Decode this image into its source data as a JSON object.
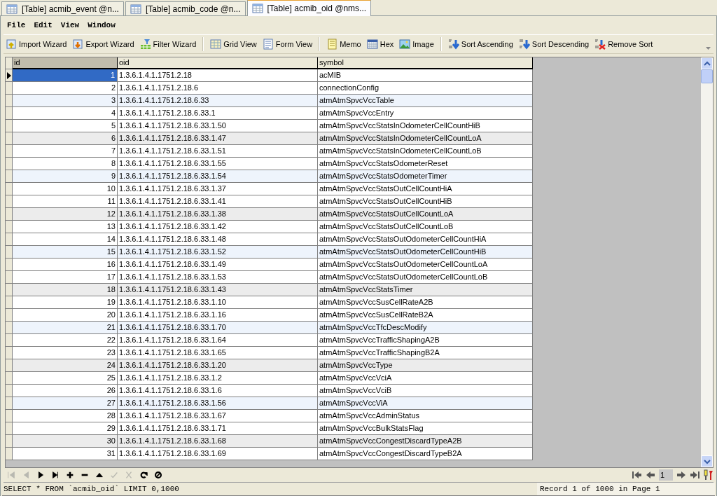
{
  "tabs": [
    {
      "label": "[Table] acmib_event @n...",
      "selected": false
    },
    {
      "label": "[Table] acmib_code @n...",
      "selected": false
    },
    {
      "label": "[Table] acmib_oid @nms...",
      "selected": true
    }
  ],
  "menu": [
    "File",
    "Edit",
    "View",
    "Window"
  ],
  "toolbar": [
    {
      "kind": "import",
      "label": "Import Wizard"
    },
    {
      "kind": "export",
      "label": "Export Wizard"
    },
    {
      "kind": "filter",
      "label": "Filter Wizard"
    },
    {
      "kind": "separator"
    },
    {
      "kind": "grid",
      "label": "Grid View"
    },
    {
      "kind": "form",
      "label": "Form View"
    },
    {
      "kind": "separator"
    },
    {
      "kind": "memo",
      "label": "Memo"
    },
    {
      "kind": "hex",
      "label": "Hex"
    },
    {
      "kind": "image",
      "label": "Image"
    },
    {
      "kind": "separator"
    },
    {
      "kind": "sort-asc",
      "label": "Sort Ascending"
    },
    {
      "kind": "sort-desc",
      "label": "Sort Descending"
    },
    {
      "kind": "sort-remove",
      "label": "Remove Sort"
    }
  ],
  "table": {
    "columns": [
      "id",
      "oid",
      "symbol"
    ],
    "rows": [
      {
        "id": "1",
        "oid": "1.3.6.1.4.1.1751.2.18",
        "symbol": "acMIB",
        "selected": true
      },
      {
        "id": "2",
        "oid": "1.3.6.1.4.1.1751.2.18.6",
        "symbol": "connectionConfig",
        "selected": false
      },
      {
        "id": "3",
        "oid": "1.3.6.1.4.1.1751.2.18.6.33",
        "symbol": "atmAtmSpvcVccTable",
        "selected": false
      },
      {
        "id": "4",
        "oid": "1.3.6.1.4.1.1751.2.18.6.33.1",
        "symbol": "atmAtmSpvcVccEntry",
        "selected": false
      },
      {
        "id": "5",
        "oid": "1.3.6.1.4.1.1751.2.18.6.33.1.50",
        "symbol": "atmAtmSpvcVccStatsInOdometerCellCountHiB",
        "selected": false
      },
      {
        "id": "6",
        "oid": "1.3.6.1.4.1.1751.2.18.6.33.1.47",
        "symbol": "atmAtmSpvcVccStatsInOdometerCellCountLoA",
        "selected": false
      },
      {
        "id": "7",
        "oid": "1.3.6.1.4.1.1751.2.18.6.33.1.51",
        "symbol": "atmAtmSpvcVccStatsInOdometerCellCountLoB",
        "selected": false
      },
      {
        "id": "8",
        "oid": "1.3.6.1.4.1.1751.2.18.6.33.1.55",
        "symbol": "atmAtmSpvcVccStatsOdometerReset",
        "selected": false
      },
      {
        "id": "9",
        "oid": "1.3.6.1.4.1.1751.2.18.6.33.1.54",
        "symbol": "atmAtmSpvcVccStatsOdometerTimer",
        "selected": false
      },
      {
        "id": "10",
        "oid": "1.3.6.1.4.1.1751.2.18.6.33.1.37",
        "symbol": "atmAtmSpvcVccStatsOutCellCountHiA",
        "selected": false
      },
      {
        "id": "11",
        "oid": "1.3.6.1.4.1.1751.2.18.6.33.1.41",
        "symbol": "atmAtmSpvcVccStatsOutCellCountHiB",
        "selected": false
      },
      {
        "id": "12",
        "oid": "1.3.6.1.4.1.1751.2.18.6.33.1.38",
        "symbol": "atmAtmSpvcVccStatsOutCellCountLoA",
        "selected": false
      },
      {
        "id": "13",
        "oid": "1.3.6.1.4.1.1751.2.18.6.33.1.42",
        "symbol": "atmAtmSpvcVccStatsOutCellCountLoB",
        "selected": false
      },
      {
        "id": "14",
        "oid": "1.3.6.1.4.1.1751.2.18.6.33.1.48",
        "symbol": "atmAtmSpvcVccStatsOutOdometerCellCountHiA",
        "selected": false
      },
      {
        "id": "15",
        "oid": "1.3.6.1.4.1.1751.2.18.6.33.1.52",
        "symbol": "atmAtmSpvcVccStatsOutOdometerCellCountHiB",
        "selected": false
      },
      {
        "id": "16",
        "oid": "1.3.6.1.4.1.1751.2.18.6.33.1.49",
        "symbol": "atmAtmSpvcVccStatsOutOdometerCellCountLoA",
        "selected": false
      },
      {
        "id": "17",
        "oid": "1.3.6.1.4.1.1751.2.18.6.33.1.53",
        "symbol": "atmAtmSpvcVccStatsOutOdometerCellCountLoB",
        "selected": false
      },
      {
        "id": "18",
        "oid": "1.3.6.1.4.1.1751.2.18.6.33.1.43",
        "symbol": "atmAtmSpvcVccStatsTimer",
        "selected": false
      },
      {
        "id": "19",
        "oid": "1.3.6.1.4.1.1751.2.18.6.33.1.10",
        "symbol": "atmAtmSpvcVccSusCellRateA2B",
        "selected": false
      },
      {
        "id": "20",
        "oid": "1.3.6.1.4.1.1751.2.18.6.33.1.16",
        "symbol": "atmAtmSpvcVccSusCellRateB2A",
        "selected": false
      },
      {
        "id": "21",
        "oid": "1.3.6.1.4.1.1751.2.18.6.33.1.70",
        "symbol": "atmAtmSpvcVccTfcDescModify",
        "selected": false
      },
      {
        "id": "22",
        "oid": "1.3.6.1.4.1.1751.2.18.6.33.1.64",
        "symbol": "atmAtmSpvcVccTrafficShapingA2B",
        "selected": false
      },
      {
        "id": "23",
        "oid": "1.3.6.1.4.1.1751.2.18.6.33.1.65",
        "symbol": "atmAtmSpvcVccTrafficShapingB2A",
        "selected": false
      },
      {
        "id": "24",
        "oid": "1.3.6.1.4.1.1751.2.18.6.33.1.20",
        "symbol": "atmAtmSpvcVccType",
        "selected": false
      },
      {
        "id": "25",
        "oid": "1.3.6.1.4.1.1751.2.18.6.33.1.2",
        "symbol": "atmAtmSpvcVccVciA",
        "selected": false
      },
      {
        "id": "26",
        "oid": "1.3.6.1.4.1.1751.2.18.6.33.1.6",
        "symbol": "atmAtmSpvcVccVciB",
        "selected": false
      },
      {
        "id": "27",
        "oid": "1.3.6.1.4.1.1751.2.18.6.33.1.56",
        "symbol": "atmAtmSpvcVccViA",
        "selected": false
      },
      {
        "id": "28",
        "oid": "1.3.6.1.4.1.1751.2.18.6.33.1.67",
        "symbol": "atmAtmSpvcVccAdminStatus",
        "selected": false
      },
      {
        "id": "29",
        "oid": "1.3.6.1.4.1.1751.2.18.6.33.1.71",
        "symbol": "atmAtmSpvcVccBulkStatsFlag",
        "selected": false
      },
      {
        "id": "30",
        "oid": "1.3.6.1.4.1.1751.2.18.6.33.1.68",
        "symbol": "atmAtmSpvcVccCongestDiscardTypeA2B",
        "selected": false
      },
      {
        "id": "31",
        "oid": "1.3.6.1.4.1.1751.2.18.6.33.1.69",
        "symbol": "atmAtmSpvcVccCongestDiscardTypeB2A",
        "selected": false
      }
    ]
  },
  "nav": [
    {
      "kind": "first",
      "disabled": true
    },
    {
      "kind": "prev",
      "disabled": true
    },
    {
      "kind": "next",
      "disabled": false
    },
    {
      "kind": "last",
      "disabled": false
    },
    {
      "kind": "add",
      "disabled": false
    },
    {
      "kind": "delete",
      "disabled": false
    },
    {
      "kind": "up",
      "disabled": false
    },
    {
      "kind": "apply",
      "disabled": true
    },
    {
      "kind": "cancel",
      "disabled": true
    },
    {
      "kind": "refresh",
      "disabled": false
    },
    {
      "kind": "stop",
      "disabled": false
    }
  ],
  "pager": {
    "page": "1"
  },
  "status_bar": {
    "query": "SELECT * FROM `acmib_oid` LIMIT 0,1000",
    "record": "Record 1 of 1000 in Page 1"
  }
}
